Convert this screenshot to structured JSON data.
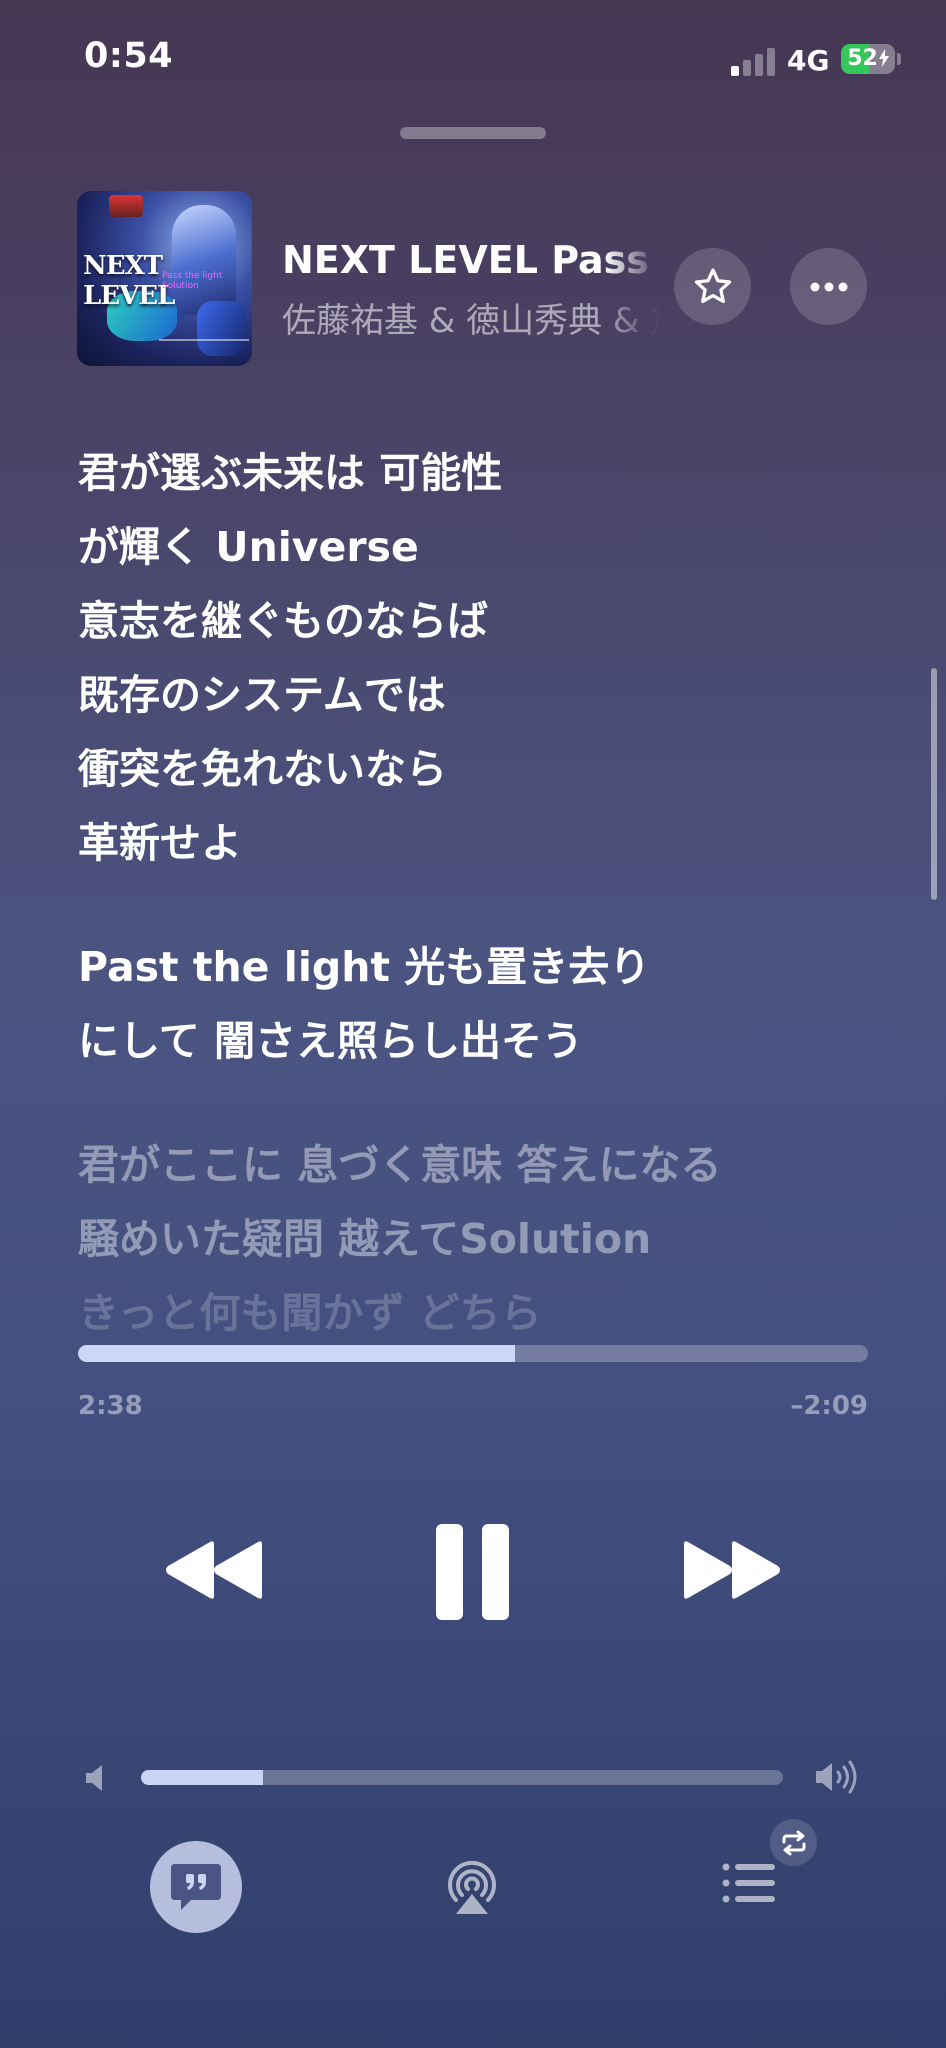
{
  "status_bar": {
    "time": "0:54",
    "network": "4G",
    "battery_percent": "52",
    "battery_level": 0.52,
    "charging": true,
    "signal_bars_active": 1,
    "signal_bars_total": 4
  },
  "now_playing": {
    "title": "NEXT LEVEL Pass the Light Solution",
    "artist": "佐藤祐基 & 徳山秀典 & 加",
    "artwork": {
      "title_text": "NEXT LEVEL",
      "subtitle_text": "Pass the light Solution"
    },
    "favorite_icon": "star-icon",
    "more_icon": "ellipsis-icon"
  },
  "lyrics": {
    "stanza1": [
      "君が選ぶ未来は 可能性",
      "が輝く Universe",
      "意志を継ぐものならば",
      "既存のシステムでは",
      "衝突を免れないなら",
      "革新せよ"
    ],
    "stanza2": [
      "Past the light 光も置き去り",
      "にして 闇さえ照らし出そう"
    ],
    "upcoming": [
      "君がここに 息づく意味 答えになる",
      "騒めいた疑問 越えてSolution",
      "きっと何も聞かず どちら"
    ]
  },
  "playback": {
    "elapsed": "2:38",
    "remaining": "–2:09",
    "progress": 0.553,
    "state": "playing"
  },
  "controls": {
    "rewind_icon": "rewind-icon",
    "pause_icon": "pause-icon",
    "forward_icon": "fast-forward-icon"
  },
  "volume": {
    "level": 0.19,
    "low_icon": "speaker-low-icon",
    "high_icon": "speaker-high-icon"
  },
  "bottom_bar": {
    "lyrics_icon": "lyrics-quote-icon",
    "lyrics_active": true,
    "airplay_icon": "airplay-icon",
    "queue_icon": "queue-list-icon",
    "repeat_icon": "repeat-icon"
  },
  "colors": {
    "battery_green": "#34c759",
    "progress_fill": "#d6e0ff"
  }
}
